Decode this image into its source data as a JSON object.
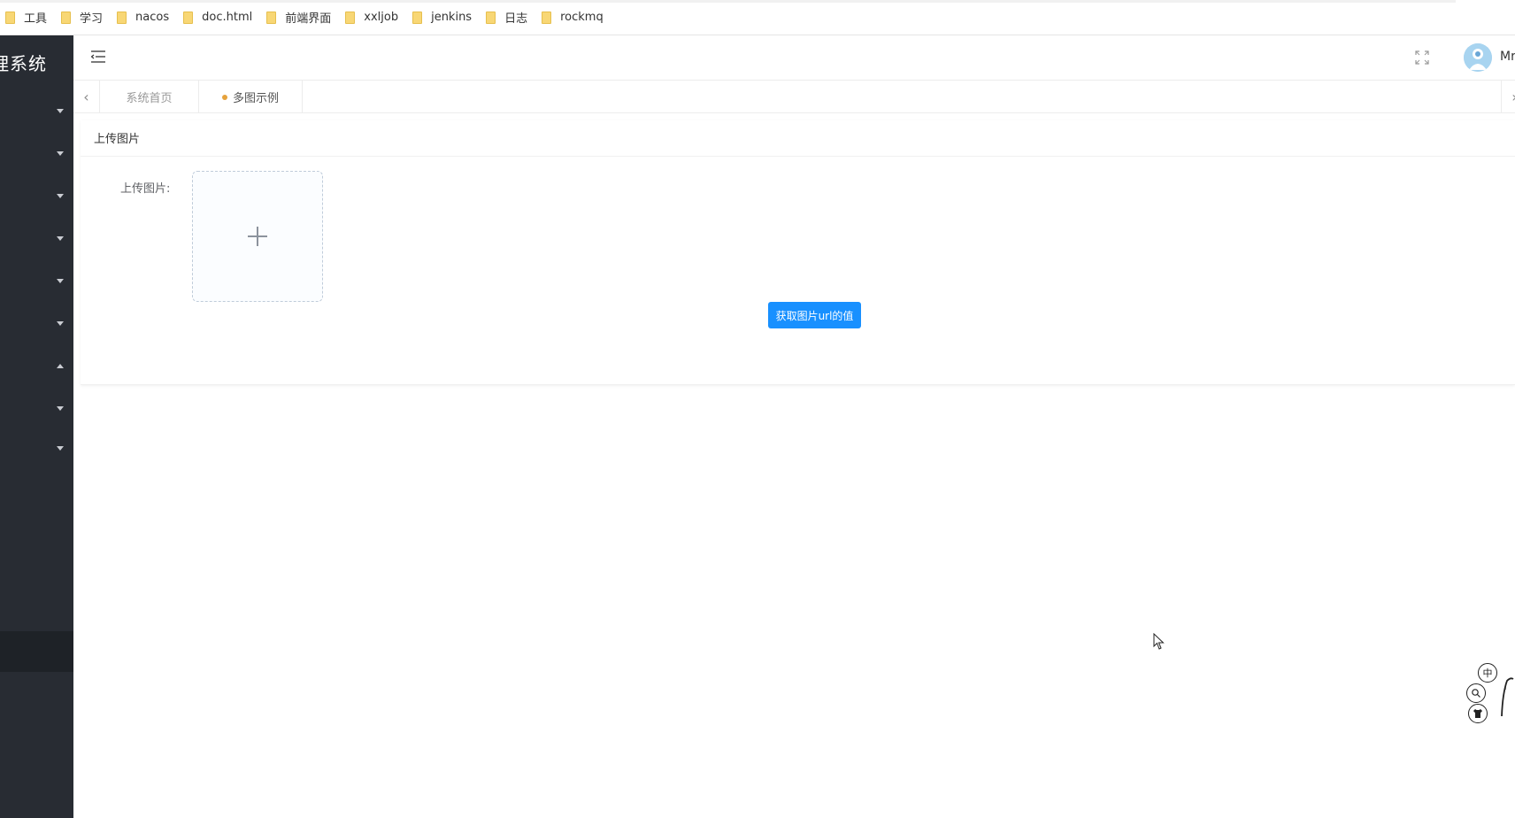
{
  "bookmarks": [
    {
      "label": "工具"
    },
    {
      "label": "学习"
    },
    {
      "label": "nacos"
    },
    {
      "label": "doc.html"
    },
    {
      "label": "前端界面"
    },
    {
      "label": "xxljob"
    },
    {
      "label": "jenkins"
    },
    {
      "label": "日志"
    },
    {
      "label": "rockmq"
    }
  ],
  "sidebar": {
    "brand": "理系统"
  },
  "header": {
    "username": "Mr"
  },
  "tabs": [
    {
      "label": "系统首页"
    },
    {
      "label": "多图示例"
    }
  ],
  "card": {
    "title": "上传图片",
    "upload_label": "上传图片:",
    "button_label": "获取图片url的值"
  },
  "float_widget": {
    "lang_label": "中"
  },
  "colors": {
    "sidebar_bg": "#282c33",
    "primary": "#1890ff",
    "active_tab_dot": "#e6a23c",
    "bookmark_folder": "#f8d775"
  }
}
